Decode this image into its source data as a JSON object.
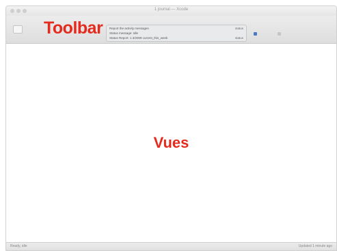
{
  "window": {
    "title": "1 journal — Xcode"
  },
  "toolbar": {
    "label": "Toolbar",
    "status_panel": {
      "lines": [
        {
          "text": "Report the activity messages",
          "right": "status"
        },
        {
          "text": "Status message: Idle",
          "right": ""
        },
        {
          "text": "Status Report: 1.3/2009 current_this_week",
          "right": "status"
        }
      ]
    },
    "icons": [
      "sidebar-toggle-icon",
      "run-icon",
      "settings-icon"
    ]
  },
  "views": {
    "label": "Vues"
  },
  "statusbar": {
    "left": "Ready, idle",
    "right": "Updated 1 minute ago"
  },
  "colors": {
    "annotation": "#e32b1e",
    "accent": "#4d79c4"
  }
}
